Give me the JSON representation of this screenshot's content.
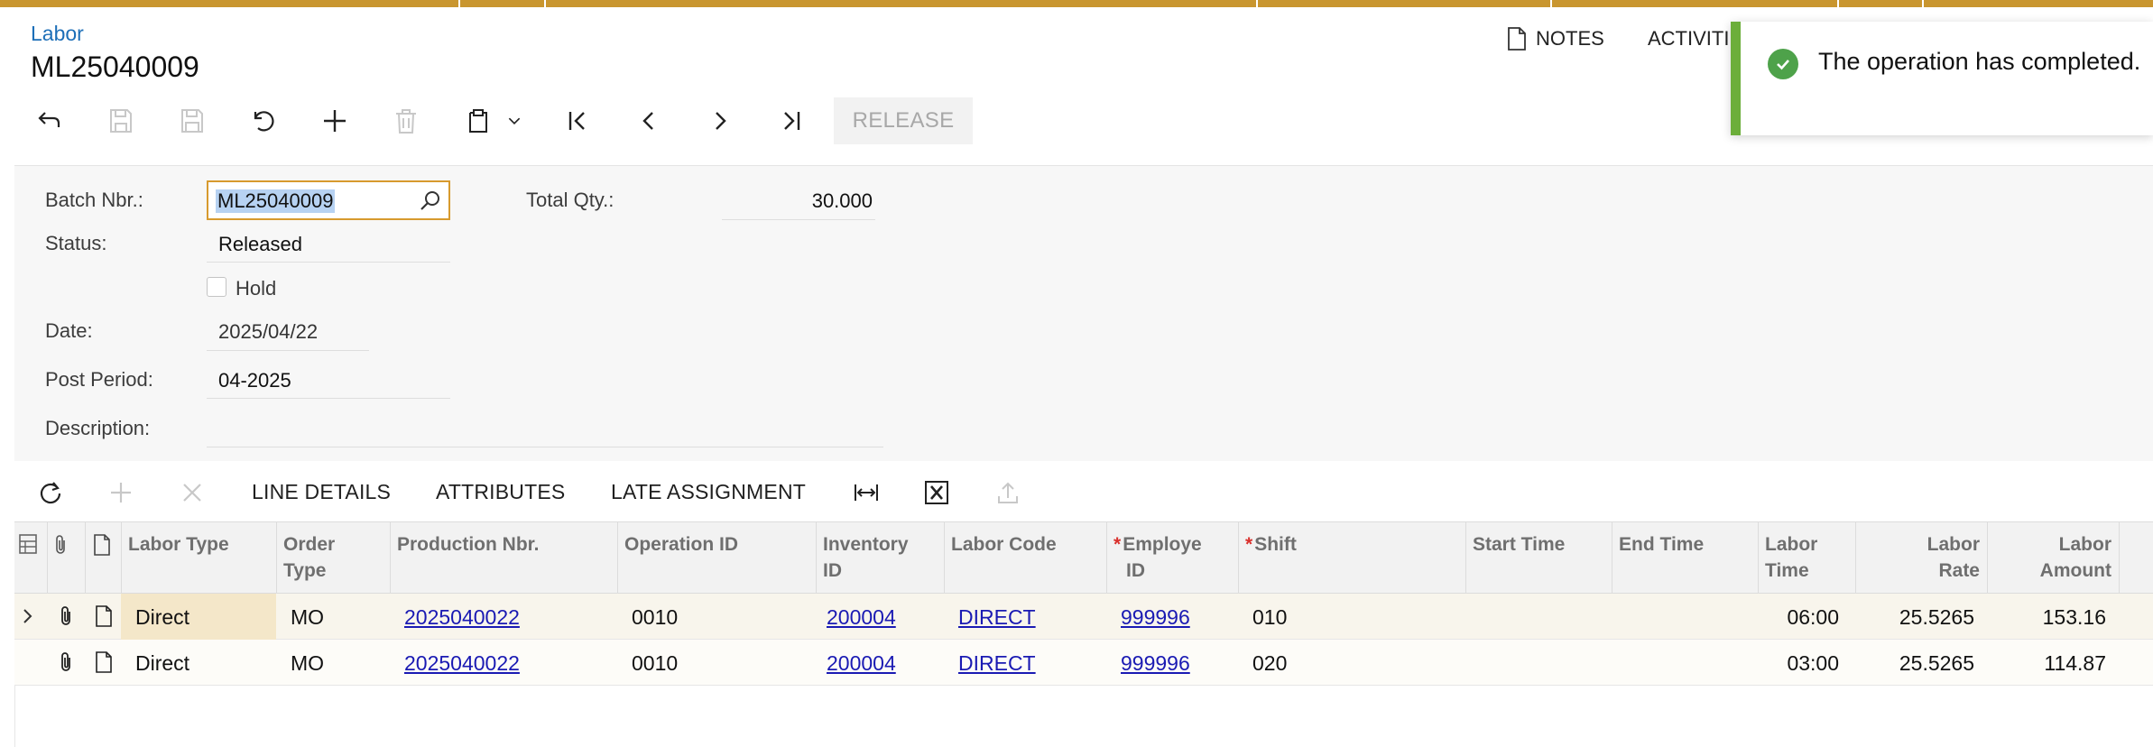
{
  "header": {
    "breadcrumb": "Labor",
    "title": "ML25040009",
    "notes_label": "NOTES",
    "activities_label": "ACTIVITI"
  },
  "toolbar": {
    "icons": [
      "back-icon",
      "save-close-icon",
      "save-icon",
      "undo-icon",
      "add-icon",
      "delete-icon",
      "copy-paste-icon",
      "chevron-down-icon",
      "first-record-icon",
      "previous-record-icon",
      "next-record-icon",
      "last-record-icon"
    ],
    "release_label": "RELEASE"
  },
  "form": {
    "batch_nbr_label": "Batch Nbr.:",
    "batch_nbr_value": "ML25040009",
    "status_label": "Status:",
    "status_value": "Released",
    "hold_label": "Hold",
    "hold_checked": false,
    "date_label": "Date:",
    "date_value": "2025/04/22",
    "post_period_label": "Post Period:",
    "post_period_value": "04-2025",
    "description_label": "Description:",
    "description_value": "",
    "total_qty_label": "Total Qty.:",
    "total_qty_value": "30.000"
  },
  "grid_toolbar": {
    "tabs": [
      "LINE DETAILS",
      "ATTRIBUTES",
      "LATE ASSIGNMENT"
    ],
    "icons": [
      "refresh-icon",
      "add-row-icon",
      "delete-row-icon",
      "fit-columns-icon",
      "excel-export-icon",
      "upload-icon"
    ]
  },
  "grid": {
    "columns": {
      "labor_type": "Labor Type",
      "order_type_1": "Order",
      "order_type_2": "Type",
      "production_nbr": "Production Nbr.",
      "operation_id": "Operation ID",
      "inventory_id_1": "Inventory",
      "inventory_id_2": "ID",
      "labor_code": "Labor Code",
      "employee_id_1": "Employe",
      "employee_id_2": "ID",
      "shift": "Shift",
      "start_time": "Start Time",
      "end_time": "End Time",
      "labor_time_1": "Labor",
      "labor_time_2": "Time",
      "labor_rate_1": "Labor",
      "labor_rate_2": "Rate",
      "labor_amount_1": "Labor",
      "labor_amount_2": "Amount"
    },
    "rows": [
      {
        "labor_type": "Direct",
        "order_type": "MO",
        "production_nbr": "2025040022",
        "operation_id": "0010",
        "inventory_id": "200004",
        "labor_code": "DIRECT",
        "employee_id": "999996",
        "shift": "010",
        "start_time": "",
        "end_time": "",
        "labor_time": "06:00",
        "labor_rate": "25.5265",
        "labor_amount": "153.16"
      },
      {
        "labor_type": "Direct",
        "order_type": "MO",
        "production_nbr": "2025040022",
        "operation_id": "0010",
        "inventory_id": "200004",
        "labor_code": "DIRECT",
        "employee_id": "999996",
        "shift": "020",
        "start_time": "",
        "end_time": "",
        "labor_time": "03:00",
        "labor_rate": "25.5265",
        "labor_amount": "114.87"
      }
    ]
  },
  "toast": {
    "message": "The operation has completed.",
    "accent_color": "#6cae3a"
  }
}
